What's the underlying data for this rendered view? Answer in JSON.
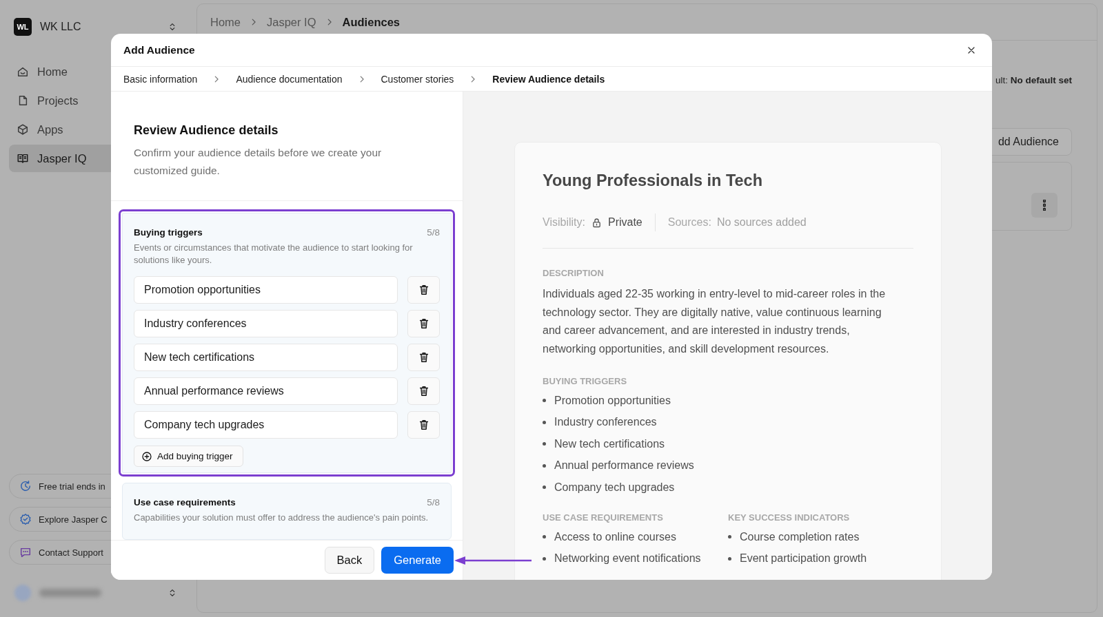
{
  "sidebar": {
    "workspace": {
      "initials": "WL",
      "name": "WK LLC"
    },
    "nav": [
      {
        "label": "Home",
        "selected": false
      },
      {
        "label": "Projects",
        "selected": false
      },
      {
        "label": "Apps",
        "selected": false
      },
      {
        "label": "Jasper IQ",
        "selected": true
      }
    ],
    "promos": [
      {
        "label": "Free trial ends in"
      },
      {
        "label": "Explore Jasper C"
      },
      {
        "label": "Contact Support"
      }
    ]
  },
  "topbar": {
    "breadcrumb": [
      {
        "label": "Home",
        "current": false
      },
      {
        "label": "Jasper IQ",
        "current": false
      },
      {
        "label": "Audiences",
        "current": true
      }
    ]
  },
  "page": {
    "default_note": "ult: **No default set**",
    "add_button": "dd Audience"
  },
  "modal": {
    "title": "Add Audience",
    "steps": [
      {
        "label": "Basic information",
        "selected": false
      },
      {
        "label": "Audience documentation",
        "selected": false
      },
      {
        "label": "Customer stories",
        "selected": false
      },
      {
        "label": "Review Audience details",
        "selected": true
      }
    ],
    "intro": {
      "title": "Review Audience details",
      "text": "Confirm your audience details before we create your customized guide."
    },
    "sections": [
      {
        "title": "Buying triggers",
        "count": "5/8",
        "description": "Events or circumstances that motivate the audience to start looking for solutions like yours.",
        "highlighted": true,
        "items": [
          "Promotion opportunities",
          "Industry conferences",
          "New tech certifications",
          "Annual performance reviews",
          "Company tech upgrades"
        ],
        "add_label": "Add buying trigger"
      },
      {
        "title": "Use case requirements",
        "count": "5/8",
        "description": "Capabilities your solution must offer to address the audience's pain points.",
        "highlighted": false
      }
    ],
    "buttons": [
      {
        "kind": "secondary",
        "label": "Back",
        "pointed_at": false
      },
      {
        "kind": "primary",
        "label": "Generate",
        "pointed_at": true
      }
    ],
    "preview": {
      "title": "Young Professionals in Tech",
      "visibility_label": "Visibility:",
      "visibility": "Private",
      "sources_label": "Sources:",
      "sources": "No sources added",
      "blocks": [
        {
          "kind": "paragraph",
          "heading": "DESCRIPTION",
          "text": "Individuals aged 22-35 working in entry-level to mid-career roles in the technology sector. They are digitally native, value continuous learning and career advancement, and are interested in industry trends, networking opportunities, and skill development resources."
        },
        {
          "kind": "list",
          "heading": "BUYING TRIGGERS",
          "items": [
            "Promotion opportunities",
            "Industry conferences",
            "New tech certifications",
            "Annual performance reviews",
            "Company tech upgrades"
          ]
        },
        {
          "kind": "columns",
          "columns": [
            {
              "heading": "USE CASE REQUIREMENTS",
              "items": [
                "Access to online courses",
                "Networking event notifications"
              ]
            },
            {
              "heading": "KEY SUCCESS INDICATORS",
              "items": [
                "Course completion rates",
                "Event participation growth"
              ]
            }
          ]
        }
      ]
    }
  }
}
